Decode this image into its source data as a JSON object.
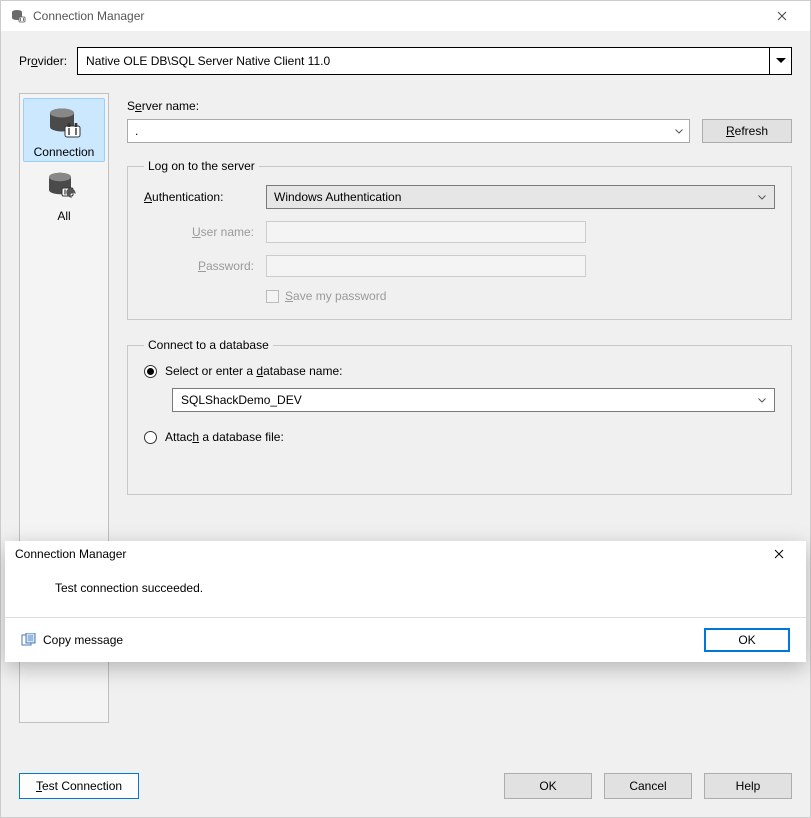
{
  "window": {
    "title": "Connection Manager"
  },
  "provider": {
    "label_prefix": "Pr",
    "label_u": "o",
    "label_suffix": "vider:",
    "value": "Native OLE DB\\SQL Server Native Client 11.0"
  },
  "sidebar": {
    "items": [
      {
        "label": "Connection",
        "selected": true
      },
      {
        "label": "All",
        "selected": false
      }
    ]
  },
  "server": {
    "label_prefix": "S",
    "label_u": "e",
    "label_suffix": "rver name:",
    "value": ".",
    "refresh_u": "R",
    "refresh_rest": "efresh"
  },
  "logon": {
    "legend": "Log on to the server",
    "auth_label_u": "A",
    "auth_label_rest": "uthentication:",
    "auth_value": "Windows Authentication",
    "user_label_u": "U",
    "user_label_rest": "ser name:",
    "user_value": "",
    "pass_label_u": "P",
    "pass_label_rest": "assword:",
    "pass_value": "",
    "save_pw_u": "S",
    "save_pw_rest": "ave my password"
  },
  "database": {
    "legend": "Connect to a database",
    "opt1_prefix": "Select or enter a ",
    "opt1_u": "d",
    "opt1_suffix": "atabase name:",
    "db_value": "SQLShackDemo_DEV",
    "opt2_prefix": "Attac",
    "opt2_u": "h",
    "opt2_suffix": " a database file:"
  },
  "buttons": {
    "test_u": "T",
    "test_rest": "est Connection",
    "ok": "OK",
    "cancel": "Cancel",
    "help": "Help"
  },
  "popup": {
    "title": "Connection Manager",
    "message": "Test connection succeeded.",
    "copy": "Copy message",
    "ok": "OK"
  }
}
